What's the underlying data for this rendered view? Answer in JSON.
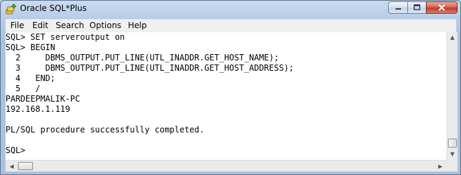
{
  "window": {
    "title": "Oracle SQL*Plus"
  },
  "menu": [
    {
      "label": "File"
    },
    {
      "label": "Edit"
    },
    {
      "label": "Search"
    },
    {
      "label": "Options"
    },
    {
      "label": "Help"
    }
  ],
  "console": {
    "lines": [
      "SQL> SET serveroutput on",
      "SQL> BEGIN",
      "  2     DBMS_OUTPUT.PUT_LINE(UTL_INADDR.GET_HOST_NAME);",
      "  3     DBMS_OUTPUT.PUT_LINE(UTL_INADDR.GET_HOST_ADDRESS);",
      "  4   END;",
      "  5   /",
      "PARDEEPMALIK-PC",
      "192.168.1.119",
      "",
      "PL/SQL procedure successfully completed.",
      "",
      "SQL>"
    ]
  },
  "icons": {
    "app": "sqlplus-app-icon",
    "minimize": "minimize-icon",
    "maximize": "maximize-icon",
    "close": "close-icon"
  }
}
